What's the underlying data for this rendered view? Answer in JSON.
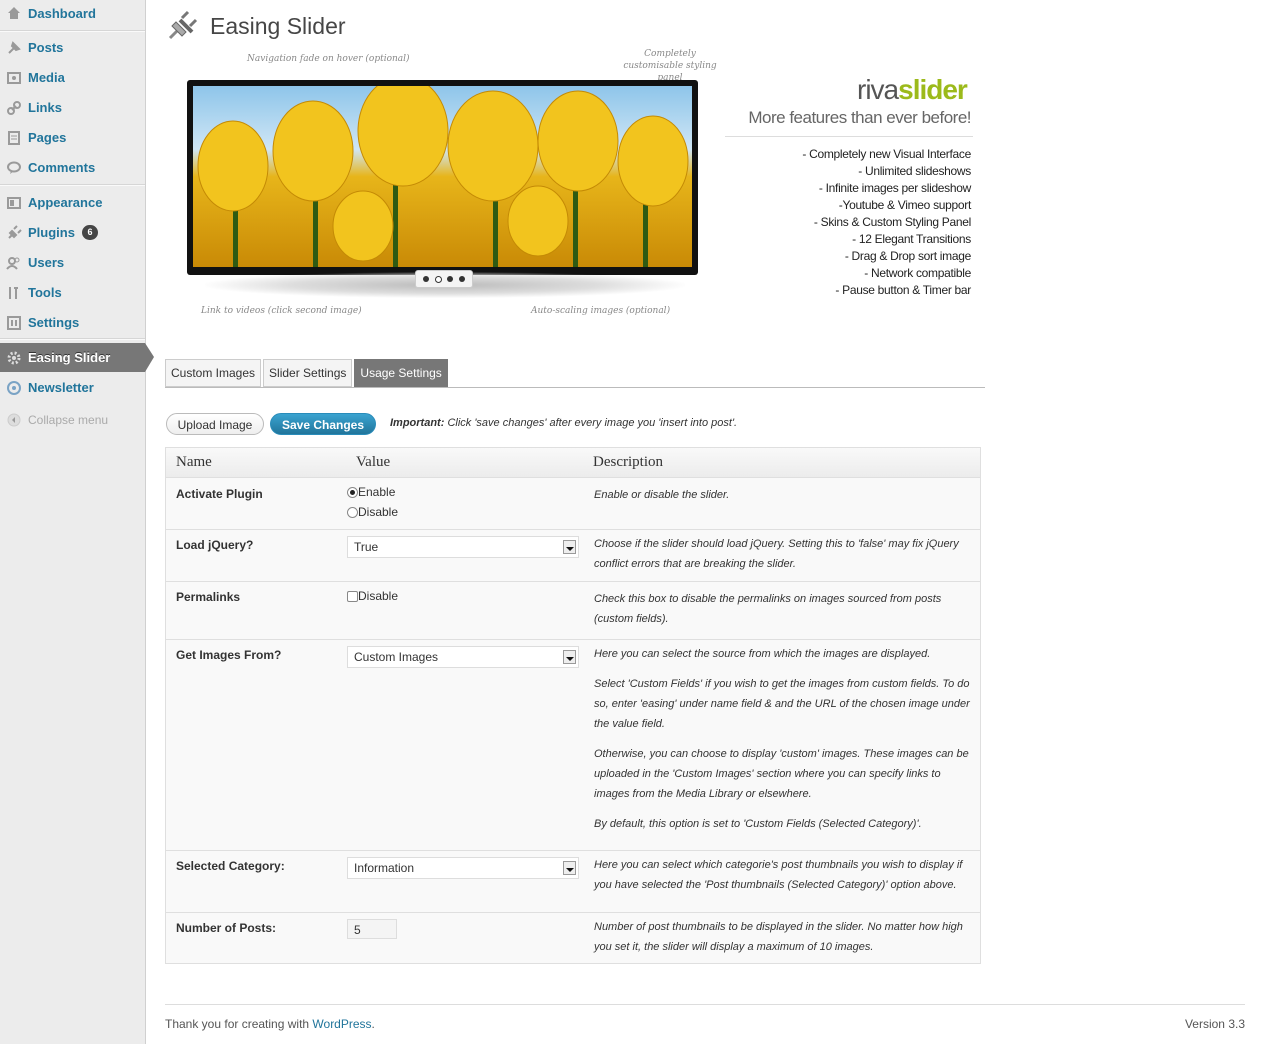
{
  "sidebar": {
    "items": [
      {
        "label": "Dashboard",
        "icon": "dashboard-icon"
      },
      {
        "label": "Posts",
        "icon": "pin-icon"
      },
      {
        "label": "Media",
        "icon": "media-icon"
      },
      {
        "label": "Links",
        "icon": "link-icon"
      },
      {
        "label": "Pages",
        "icon": "page-icon"
      },
      {
        "label": "Comments",
        "icon": "comment-icon"
      },
      {
        "label": "Appearance",
        "icon": "appearance-icon"
      },
      {
        "label": "Plugins",
        "icon": "plug-icon",
        "badge": "6"
      },
      {
        "label": "Users",
        "icon": "users-icon"
      },
      {
        "label": "Tools",
        "icon": "tools-icon"
      },
      {
        "label": "Settings",
        "icon": "settings-icon"
      },
      {
        "label": "Easing Slider",
        "icon": "gear-icon"
      },
      {
        "label": "Newsletter",
        "icon": "newsletter-icon"
      }
    ],
    "collapse_label": "Collapse menu",
    "current": "Easing Slider"
  },
  "page": {
    "title": "Easing Slider"
  },
  "banner": {
    "annotation_nav": "Navigation fade on hover (optional)",
    "annotation_styling": "Completely customisable styling panel",
    "annotation_videos": "Link to videos (click second image)",
    "annotation_scaling": "Auto-scaling images (optional)",
    "brand_light": "riva",
    "brand_bold": "slider",
    "tagline": "More features than ever before!",
    "features": [
      "- Completely new Visual Interface",
      "- Unlimited slideshows",
      "- Infinite images per slideshow",
      "-Youtube  & Vimeo support",
      "- Skins & Custom Styling Panel",
      "- 12 Elegant Transitions",
      "- Drag & Drop sort image",
      "- Network compatible",
      "- Pause button & Timer bar"
    ]
  },
  "tabs": [
    "Custom Images",
    "Slider Settings",
    "Usage Settings"
  ],
  "active_tab": "Usage Settings",
  "buttons": {
    "upload": "Upload Image",
    "save": "Save Changes",
    "important_label": "Important:",
    "important_text": " Click 'save changes' after every image you 'insert into post'."
  },
  "table": {
    "headers": {
      "name": "Name",
      "value": "Value",
      "description": "Description"
    },
    "rows": {
      "activate": {
        "name": "Activate Plugin",
        "options": [
          "Enable",
          "Disable"
        ],
        "selected": "Enable",
        "desc": "Enable or disable the slider."
      },
      "jquery": {
        "name": "Load jQuery?",
        "value": "True",
        "desc": "Choose if the slider should load jQuery. Setting this to 'false' may fix jQuery conflict errors that are breaking the slider."
      },
      "permalinks": {
        "name": "Permalinks",
        "checkbox_label": "Disable",
        "checked": false,
        "desc": "Check this box to disable the permalinks on images sourced from posts (custom fields)."
      },
      "images_from": {
        "name": "Get Images From?",
        "value": "Custom Images",
        "desc": [
          "Here you can select the source from which the images are displayed.",
          "Select 'Custom Fields' if you wish to get the images from custom fields. To do so, enter 'easing' under name field & and the URL of the chosen image under the value field.",
          "Otherwise, you can choose to display 'custom' images. These images can be uploaded in the 'Custom Images' section where you can specify links to images from the Media Library or elsewhere.",
          "By default, this option is set to 'Custom Fields (Selected Category)'."
        ]
      },
      "category": {
        "name": "Selected Category:",
        "value": "Information",
        "desc": "Here you can select which categorie's post thumbnails you wish to display if you have selected the 'Post thumbnails (Selected Category)' option above."
      },
      "num_posts": {
        "name": "Number of Posts:",
        "value": "5",
        "desc": "Number of post thumbnails to be displayed in the slider. No matter how high you set it, the slider will display a maximum of 10 images."
      }
    }
  },
  "footer": {
    "thanks_prefix": "Thank you for creating with ",
    "thanks_link": "WordPress",
    "thanks_suffix": ".",
    "version": "Version 3.3"
  },
  "colors": {
    "link": "#21759b",
    "brand_green": "#9cba1b",
    "current_menu": "#777777",
    "primary_button": "#21759b"
  }
}
